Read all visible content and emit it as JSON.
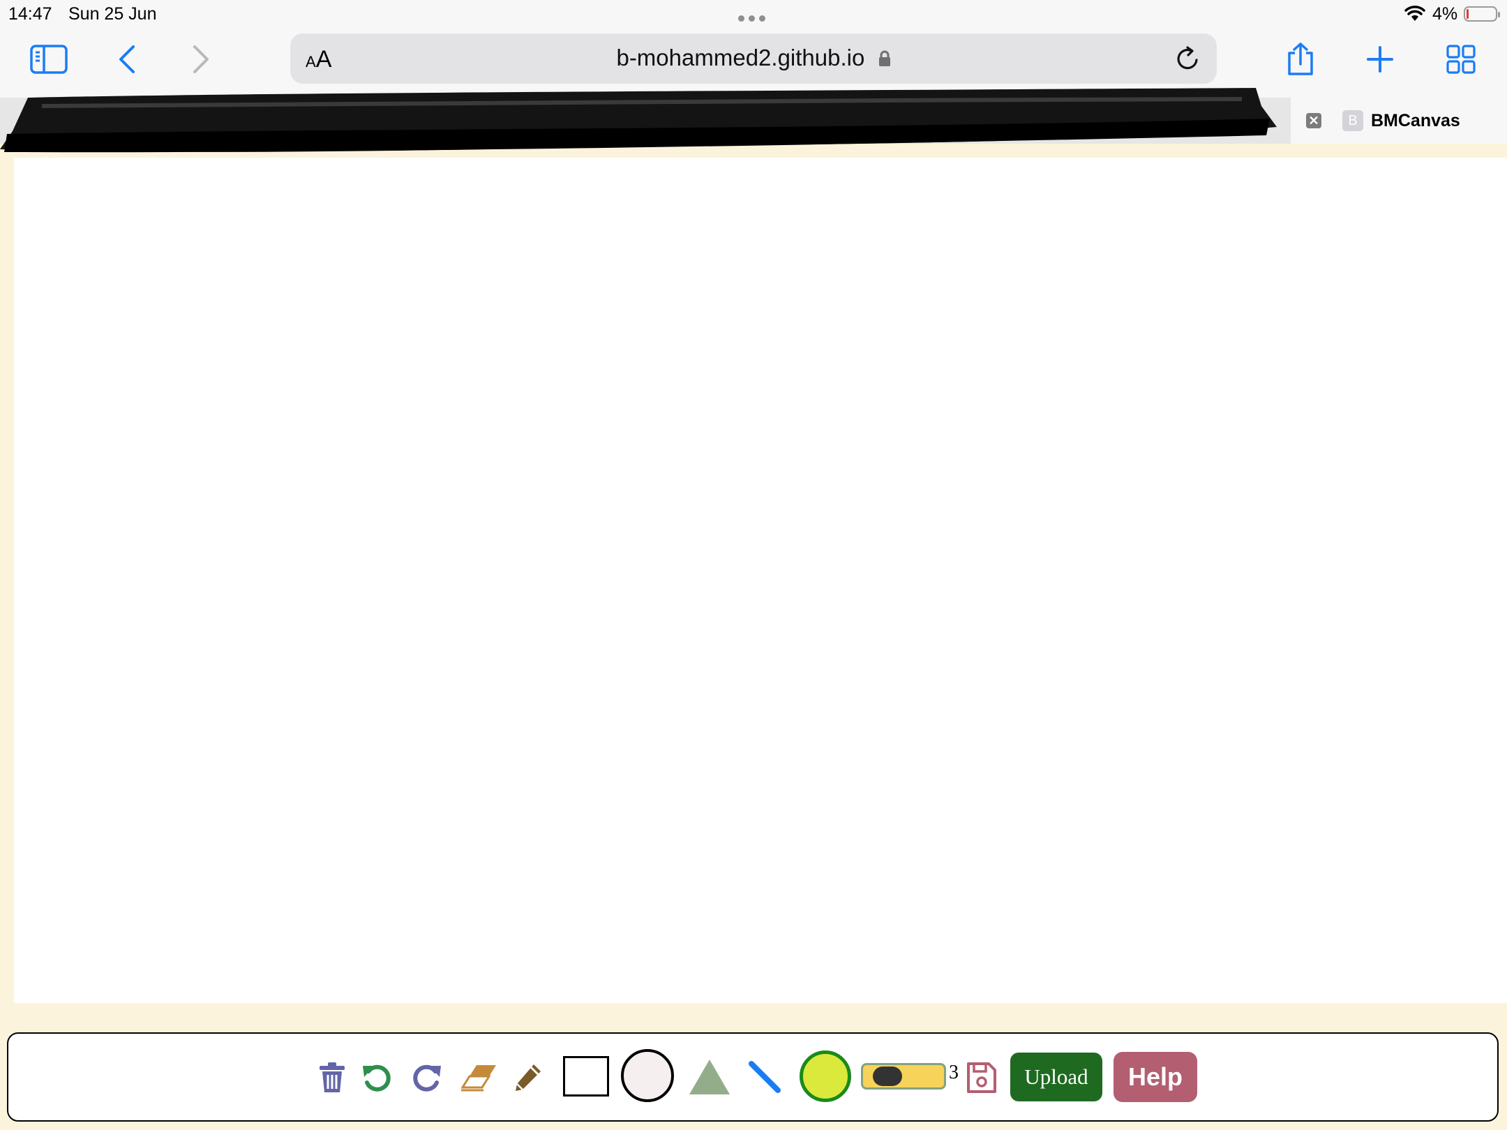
{
  "status_bar": {
    "time": "14:47",
    "date": "Sun 25 Jun",
    "battery_text": "4%",
    "battery_level": 0.04
  },
  "browser": {
    "aa_small": "A",
    "aa_large": "A",
    "url": "b-mohammed2.github.io",
    "active_tab": {
      "title": "BMCanvas",
      "favicon_letter": "B"
    },
    "icons": [
      "sidebar-icon",
      "back-icon",
      "forward-icon",
      "lock-icon",
      "reload-icon",
      "share-icon",
      "plus-icon",
      "tabs-grid-icon",
      "close-icon",
      "wifi-icon"
    ]
  },
  "toolbar": {
    "tools": [
      "trash-icon",
      "undo-icon",
      "redo-icon",
      "eraser-icon",
      "pencil-icon",
      "rectangle-tool",
      "circle-tool",
      "triangle-tool",
      "line-tool",
      "color-picker",
      "size-slider",
      "save-icon"
    ],
    "brush_size": "3",
    "brush_size_fraction": 0.15,
    "upload_label": "Upload",
    "help_label": "Help",
    "colors": {
      "selected_color": "#dbe93c",
      "upload_bg": "#1f6a21",
      "help_bg": "#b35e71",
      "accent": "#1a7cf5"
    }
  }
}
